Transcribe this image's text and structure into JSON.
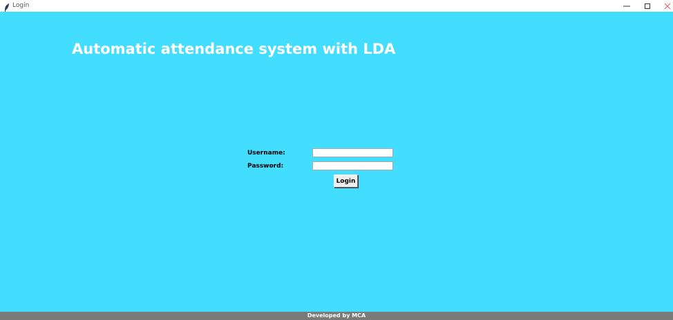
{
  "window": {
    "title": "Login",
    "app_icon": "feather-icon",
    "minimize_icon": "minimize-icon",
    "maximize_icon": "maximize-icon",
    "close_icon": "close-icon"
  },
  "main": {
    "heading": "Automatic attendance system with LDA",
    "username_label": "Username:",
    "username_value": "",
    "password_label": "Password:",
    "password_value": "",
    "login_label": "Login"
  },
  "footer": {
    "text": "Developed by MCA"
  },
  "colors": {
    "background": "#42ddff",
    "heading": "#ffffff",
    "footer_background": "#7a7a7a",
    "footer_text": "#ffffff",
    "titlebar": "#ffffff",
    "close_hover": "#e81123"
  }
}
